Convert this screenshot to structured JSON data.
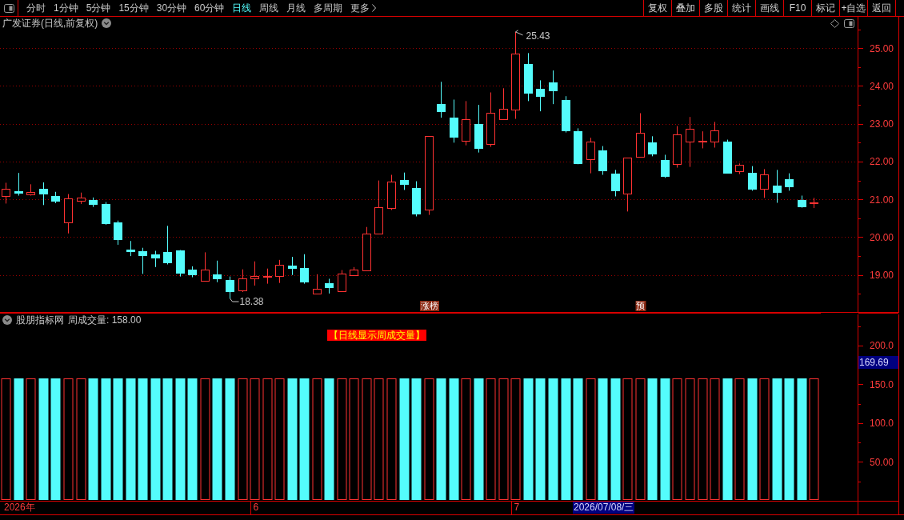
{
  "toolbar": {
    "periods": [
      {
        "label": "分时",
        "selected": false
      },
      {
        "label": "1分钟",
        "selected": false
      },
      {
        "label": "5分钟",
        "selected": false
      },
      {
        "label": "15分钟",
        "selected": false
      },
      {
        "label": "30分钟",
        "selected": false
      },
      {
        "label": "60分钟",
        "selected": false
      },
      {
        "label": "日线",
        "selected": true
      },
      {
        "label": "周线",
        "selected": false
      },
      {
        "label": "月线",
        "selected": false
      },
      {
        "label": "多周期",
        "selected": false
      }
    ],
    "more": "更多",
    "tools": [
      "复权",
      "叠加",
      "多股",
      "统计",
      "画线",
      "F10",
      "标记",
      "+自选",
      "返回"
    ]
  },
  "price_pane": {
    "title": "广发证券(日线,前复权)",
    "chart_data": [
      {
        "type": "candlestick",
        "ylim": [
          18.0,
          25.83
        ],
        "yticks": [
          {
            "value": 19,
            "label": "19.00"
          },
          {
            "value": 20,
            "label": "20.00"
          },
          {
            "value": 21,
            "label": "21.00"
          },
          {
            "value": 22,
            "label": "22.00"
          },
          {
            "value": 23,
            "label": "23.00"
          },
          {
            "value": 24,
            "label": "24.00"
          },
          {
            "value": 25,
            "label": "25.00"
          }
        ],
        "grid": true,
        "annotations": [
          "25.43",
          "18.38"
        ],
        "categories": [
          null,
          null,
          null,
          null,
          null,
          null,
          null,
          null,
          null,
          null,
          null,
          null,
          null,
          null,
          null,
          null,
          null,
          null,
          null,
          null,
          null,
          null,
          null,
          null,
          null,
          null,
          null,
          null,
          null,
          null,
          null,
          null,
          null,
          null,
          "涨榜",
          null,
          null,
          null,
          null,
          null,
          null,
          null,
          null,
          null,
          null,
          null,
          null,
          null,
          null,
          null,
          null,
          "预",
          null,
          null,
          null,
          null,
          null,
          null,
          null,
          null,
          null,
          null,
          null,
          null,
          null,
          null
        ],
        "ohlc": [
          [
            21.08,
            21.44,
            20.89,
            21.27
          ],
          [
            21.22,
            21.7,
            21.1,
            21.18
          ],
          [
            21.13,
            21.4,
            21.1,
            21.2
          ],
          [
            21.29,
            21.45,
            20.85,
            21.16
          ],
          [
            21.08,
            21.2,
            20.9,
            20.97
          ],
          [
            20.4,
            21.14,
            20.1,
            21.03
          ],
          [
            20.97,
            21.18,
            20.88,
            21.05
          ],
          [
            20.99,
            21.05,
            20.8,
            20.87
          ],
          [
            20.87,
            20.93,
            20.33,
            20.38
          ],
          [
            20.4,
            20.44,
            19.8,
            19.95
          ],
          [
            19.68,
            19.9,
            19.5,
            19.62
          ],
          [
            19.64,
            19.72,
            19.03,
            19.53
          ],
          [
            19.55,
            19.64,
            19.21,
            19.45
          ],
          [
            19.6,
            20.3,
            19.28,
            19.34
          ],
          [
            19.66,
            19.66,
            18.96,
            19.06
          ],
          [
            19.15,
            19.23,
            18.94,
            19.02
          ],
          [
            18.85,
            19.6,
            18.85,
            19.15
          ],
          [
            19.02,
            19.38,
            18.81,
            18.9
          ],
          [
            18.87,
            18.96,
            18.38,
            18.57
          ],
          [
            18.6,
            19.15,
            18.55,
            18.9
          ],
          [
            18.9,
            19.36,
            18.72,
            18.98
          ],
          [
            18.95,
            19.17,
            18.77,
            18.98
          ],
          [
            18.98,
            19.4,
            18.79,
            19.28
          ],
          [
            19.25,
            19.48,
            19.0,
            19.18
          ],
          [
            19.18,
            19.55,
            18.77,
            18.83
          ],
          [
            18.51,
            19.02,
            18.51,
            18.64
          ],
          [
            18.79,
            18.9,
            18.51,
            18.68
          ],
          [
            18.58,
            19.13,
            18.56,
            19.04
          ],
          [
            19.0,
            19.21,
            19.0,
            19.15
          ],
          [
            19.13,
            20.27,
            19.11,
            20.1
          ],
          [
            20.1,
            21.5,
            20.08,
            20.8
          ],
          [
            20.78,
            21.65,
            20.72,
            21.48
          ],
          [
            21.52,
            21.71,
            21.25,
            21.4
          ],
          [
            21.31,
            21.48,
            20.55,
            20.63
          ],
          [
            20.72,
            22.67,
            20.59,
            22.67
          ],
          [
            23.52,
            24.11,
            23.16,
            23.33
          ],
          [
            23.16,
            23.64,
            22.5,
            22.65
          ],
          [
            22.54,
            23.6,
            22.43,
            23.13
          ],
          [
            23.0,
            23.5,
            22.24,
            22.35
          ],
          [
            22.46,
            23.83,
            22.39,
            23.28
          ],
          [
            23.13,
            23.94,
            23.13,
            23.39
          ],
          [
            23.37,
            25.43,
            23.13,
            24.85
          ],
          [
            24.58,
            24.87,
            23.6,
            23.81
          ],
          [
            23.92,
            24.15,
            23.33,
            23.73
          ],
          [
            24.09,
            24.41,
            23.52,
            23.88
          ],
          [
            23.62,
            23.73,
            22.77,
            22.82
          ],
          [
            22.8,
            22.88,
            21.93,
            21.95
          ],
          [
            22.07,
            22.63,
            21.69,
            22.52
          ],
          [
            22.29,
            22.41,
            21.65,
            21.76
          ],
          [
            21.69,
            21.78,
            21.08,
            21.23
          ],
          [
            21.16,
            22.1,
            20.68,
            22.1
          ],
          [
            22.12,
            23.28,
            22.12,
            22.77
          ],
          [
            22.5,
            22.67,
            22.14,
            22.22
          ],
          [
            22.05,
            22.18,
            21.57,
            21.61
          ],
          [
            21.93,
            22.94,
            21.84,
            22.71
          ],
          [
            22.52,
            23.18,
            21.86,
            22.86
          ],
          [
            22.52,
            22.8,
            22.35,
            22.54
          ],
          [
            22.52,
            23.05,
            22.37,
            22.82
          ],
          [
            22.52,
            22.58,
            21.69,
            21.71
          ],
          [
            21.74,
            21.95,
            21.67,
            21.91
          ],
          [
            21.71,
            21.88,
            21.23,
            21.29
          ],
          [
            21.27,
            21.8,
            21.04,
            21.67
          ],
          [
            21.37,
            21.78,
            20.91,
            21.2
          ],
          [
            21.54,
            21.69,
            21.23,
            21.35
          ],
          [
            20.99,
            21.1,
            20.78,
            20.82
          ],
          [
            20.9,
            21.04,
            20.77,
            20.93
          ]
        ]
      }
    ]
  },
  "indicator_pane": {
    "source": "股朋指标网",
    "reading": "周成交量: 158.00",
    "badge": "【日线显示周成交量】",
    "crosshair_value": "169.69",
    "chart_data": [
      {
        "type": "bar",
        "ylim": [
          0,
          242
        ],
        "yticks": [
          {
            "value": 50,
            "label": "50.00"
          },
          {
            "value": 100,
            "label": "100.0"
          },
          {
            "value": 150,
            "label": "150.0"
          },
          {
            "value": 200,
            "label": "200.0"
          }
        ],
        "categories": [
          null,
          null,
          null,
          null,
          null,
          null,
          null,
          null,
          null,
          null,
          null,
          null,
          null,
          null,
          null,
          null,
          null,
          null,
          null,
          null,
          "6",
          null,
          null,
          null,
          null,
          null,
          null,
          null,
          null,
          null,
          null,
          null,
          null,
          null,
          null,
          null,
          null,
          null,
          null,
          null,
          null,
          "7",
          null,
          null,
          null,
          null,
          null,
          null,
          null,
          null,
          null,
          null,
          null,
          null,
          null,
          null,
          null,
          null,
          null,
          null,
          null,
          null,
          null,
          null,
          null,
          null
        ],
        "values": [
          158,
          158,
          158,
          158,
          158,
          158,
          158,
          158,
          158,
          158,
          158,
          158,
          158,
          158,
          158,
          158,
          158,
          158,
          158,
          158,
          158,
          158,
          158,
          158,
          158,
          158,
          158,
          158,
          158,
          158,
          158,
          158,
          158,
          158,
          158,
          158,
          158,
          158,
          158,
          158,
          158,
          158,
          158,
          158,
          158,
          158,
          158,
          158,
          158,
          158,
          158,
          158,
          158,
          158,
          158,
          158,
          158,
          158,
          158,
          158,
          158,
          158,
          158,
          158,
          158,
          158
        ],
        "colors": [
          "#ff3232",
          "#54fcfc",
          "#ff3232",
          "#54fcfc",
          "#54fcfc",
          "#ff3232",
          "#ff3232",
          "#54fcfc",
          "#54fcfc",
          "#54fcfc",
          "#54fcfc",
          "#54fcfc",
          "#54fcfc",
          "#54fcfc",
          "#54fcfc",
          "#54fcfc",
          "#ff3232",
          "#54fcfc",
          "#54fcfc",
          "#ff3232",
          "#ff3232",
          "#ff3232",
          "#ff3232",
          "#54fcfc",
          "#54fcfc",
          "#ff3232",
          "#54fcfc",
          "#ff3232",
          "#ff3232",
          "#ff3232",
          "#ff3232",
          "#ff3232",
          "#54fcfc",
          "#54fcfc",
          "#ff3232",
          "#54fcfc",
          "#54fcfc",
          "#ff3232",
          "#54fcfc",
          "#ff3232",
          "#ff3232",
          "#ff3232",
          "#54fcfc",
          "#54fcfc",
          "#54fcfc",
          "#54fcfc",
          "#54fcfc",
          "#ff3232",
          "#54fcfc",
          "#54fcfc",
          "#ff3232",
          "#ff3232",
          "#54fcfc",
          "#54fcfc",
          "#ff3232",
          "#ff3232",
          "#ff3232",
          "#ff3232",
          "#54fcfc",
          "#ff3232",
          "#54fcfc",
          "#ff3232",
          "#54fcfc",
          "#54fcfc",
          "#54fcfc",
          "#ff3232"
        ]
      }
    ]
  },
  "date_axis": {
    "year": "2026年",
    "crosshair_date": "2026/07/08/三"
  }
}
